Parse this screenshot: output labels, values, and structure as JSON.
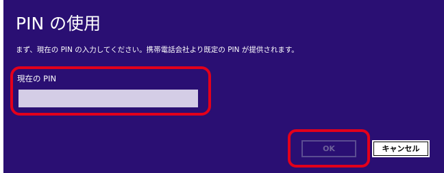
{
  "dialog": {
    "title": "PIN の使用",
    "instructions": "まず、現在の PIN の入力してください。携帯電話会社より既定の PIN が提供されます。",
    "pin_label": "現在の PIN",
    "pin_value": "",
    "ok_label": "OK",
    "cancel_label": "キャンセル"
  },
  "colors": {
    "background": "#2a0f73",
    "input_fill": "#d4cde6",
    "highlight": "#e3001b"
  }
}
